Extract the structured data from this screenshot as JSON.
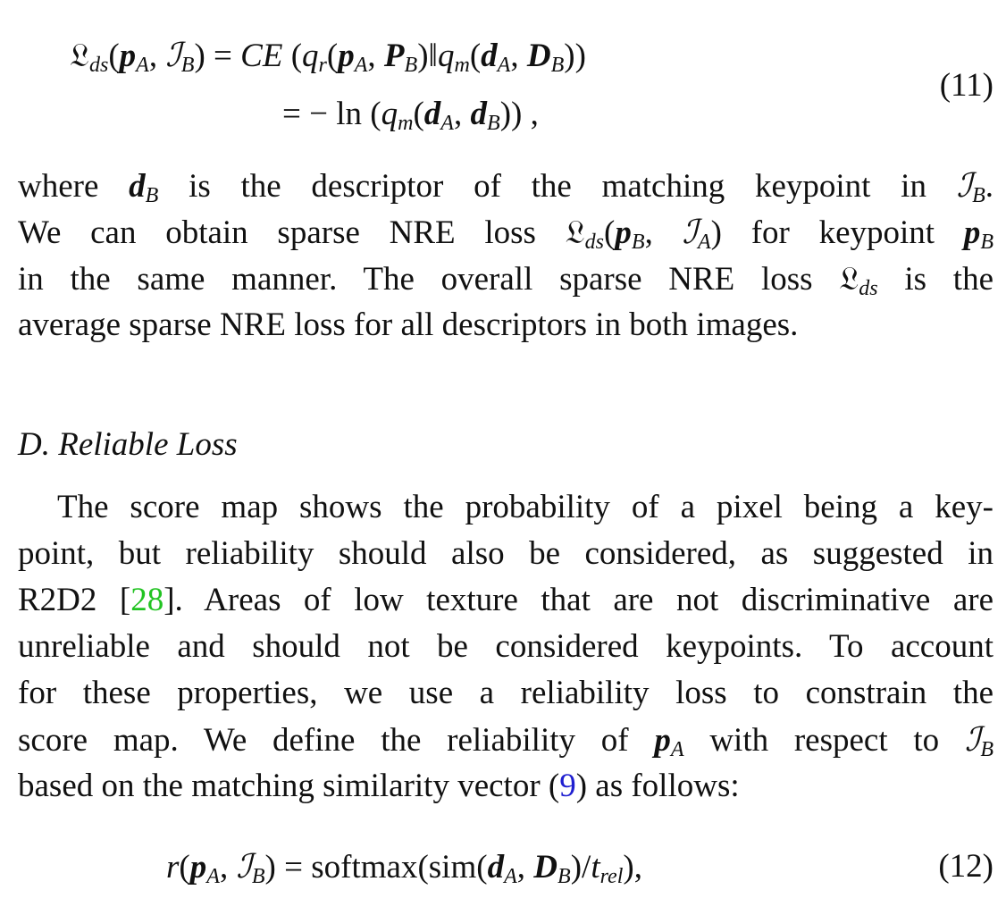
{
  "eq11": {
    "line1_lhs": "𝔏",
    "line1_sub": "ds",
    "ce": "CE",
    "number": "(11)"
  },
  "eq12": {
    "number": "(12)",
    "func": "softmax",
    "sim": "sim"
  },
  "para1": {
    "l1a": "where",
    "l1b": "is the descriptor of the matching keypoint in",
    "l2a": "We can obtain sparse NRE loss",
    "l2b": "for keypoint",
    "l3": "in the same manner. The overall sparse NRE loss",
    "l3b": "is the",
    "l4": "average sparse NRE loss for all descriptors in both images."
  },
  "section": {
    "heading": "D.  Reliable Loss"
  },
  "para2": {
    "l1": "The score map shows the probability of a pixel being a key-",
    "l2": "point, but reliability should also be considered, as suggested in",
    "l3a": "R2D2 [",
    "cite": "28",
    "l3b": "]. Areas of low texture that are not discriminative are",
    "l4": "unreliable and should not be considered keypoints. To account",
    "l5": "for these properties, we use a reliability loss to constrain the",
    "l6a": "score map. We define the reliability of",
    "l6b": "with respect to",
    "l7a": "based on the matching similarity vector (",
    "ref": "9",
    "l7b": ") as follows:"
  }
}
